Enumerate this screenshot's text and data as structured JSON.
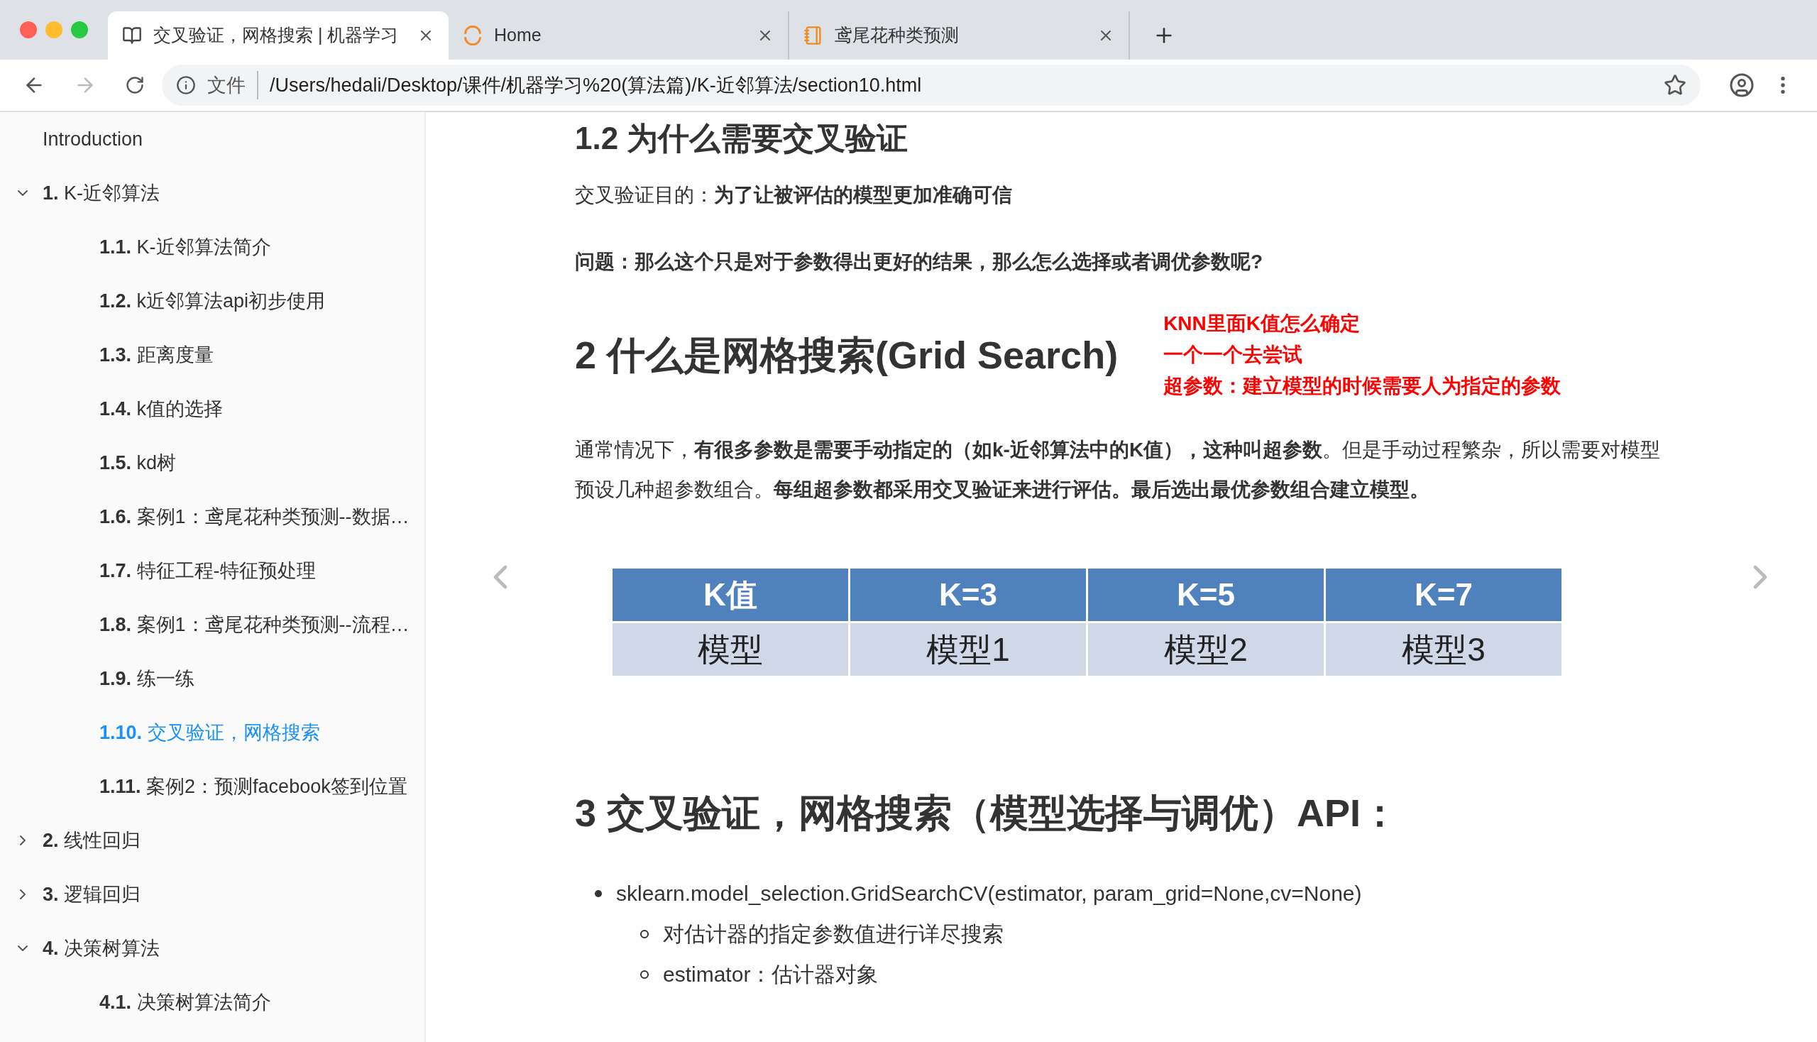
{
  "tabs": [
    {
      "title": "交叉验证，网格搜索 | 机器学习",
      "selected": true,
      "kind": "book"
    },
    {
      "title": "Home",
      "selected": false,
      "kind": "spinner"
    },
    {
      "title": "鸢尾花种类预测",
      "selected": false,
      "kind": "notebook"
    }
  ],
  "address_bar": {
    "scheme": "文件",
    "url": "/Users/hedali/Desktop/课件/机器学习%20(算法篇)/K-近邻算法/section10.html"
  },
  "sidebar": {
    "items": [
      {
        "title": "Introduction",
        "selected": false
      },
      {
        "number": "1.",
        "title": "K-近邻算法",
        "selected": false,
        "expanded": true,
        "children": [
          {
            "number": "1.1.",
            "title": "K-近邻算法简介",
            "selected": false
          },
          {
            "number": "1.2.",
            "title": "k近邻算法api初步使用",
            "selected": false
          },
          {
            "number": "1.3.",
            "title": "距离度量",
            "selected": false
          },
          {
            "number": "1.4.",
            "title": "k值的选择",
            "selected": false
          },
          {
            "number": "1.5.",
            "title": "kd树",
            "selected": false
          },
          {
            "number": "1.6.",
            "title": "案例1：鸢尾花种类预测--数据…",
            "selected": false
          },
          {
            "number": "1.7.",
            "title": "特征工程-特征预处理",
            "selected": false
          },
          {
            "number": "1.8.",
            "title": "案例1：鸢尾花种类预测--流程…",
            "selected": false
          },
          {
            "number": "1.9.",
            "title": "练一练",
            "selected": false
          },
          {
            "number": "1.10.",
            "title": "交叉验证，网格搜索",
            "selected": true
          },
          {
            "number": "1.11.",
            "title": "案例2：预测facebook签到位置",
            "selected": false
          }
        ]
      },
      {
        "number": "2.",
        "title": "线性回归",
        "selected": false,
        "expanded": false
      },
      {
        "number": "3.",
        "title": "逻辑回归",
        "selected": false,
        "expanded": false
      },
      {
        "number": "4.",
        "title": "决策树算法",
        "selected": false,
        "expanded": true,
        "children": [
          {
            "number": "4.1.",
            "title": "决策树算法简介",
            "selected": false
          }
        ]
      }
    ]
  },
  "content": {
    "heading_1": "1.2 为什么需要交叉验证",
    "purpose": "交叉验证目的：**为了让被评估的模型更加准确可信**",
    "question": "问题：那么这个只是对于参数得出更好的结果，那么怎么选择或者调优参数呢?",
    "heading_2": "2 什么是网格搜索(Grid Search)",
    "annotations": [
      "KNN里面K值怎么确定",
      "一个一个去尝试",
      "超参数：建立模型的时候需要人为指定的参数"
    ],
    "paragraph": "通常情况下，**有很多参数是需要手动指定的（如k-近邻算法中的K值），这种叫超参数**。但是手动过程繁杂，所以需要对模型预设几种超参数组合。**每组超参数都采用交叉验证来进行评估。最后选出最优参数组合建立模型。**",
    "table": {
      "columns": [
        "K值",
        "K=3",
        "K=5",
        "K=7"
      ],
      "rows": [
        [
          "模型",
          "模型1",
          "模型2",
          "模型3"
        ]
      ]
    },
    "heading_3": "3 交叉验证，网格搜索（模型选择与调优）API：",
    "api": {
      "signature": "sklearn.model_selection.GridSearchCV(estimator, param_grid=None,cv=None)",
      "details": [
        "对估计器的指定参数值进行详尽搜索",
        "estimator：估计器对象"
      ]
    }
  }
}
